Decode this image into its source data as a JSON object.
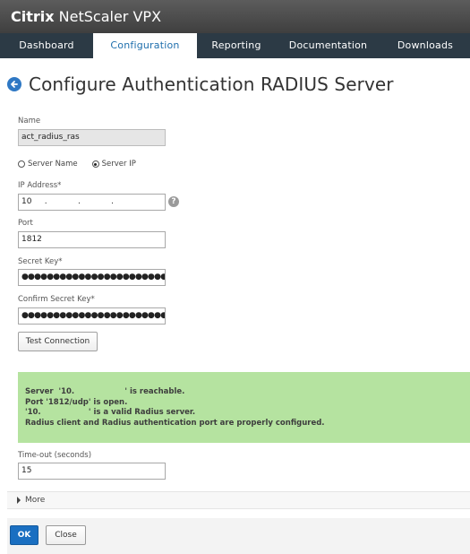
{
  "app": {
    "brand_bold": "Citrix",
    "brand_rest": "NetScaler VPX"
  },
  "nav": {
    "tabs": [
      {
        "label": "Dashboard"
      },
      {
        "label": "Configuration"
      },
      {
        "label": "Reporting"
      },
      {
        "label": "Documentation"
      },
      {
        "label": "Downloads"
      }
    ],
    "active_tab": "Configuration"
  },
  "page": {
    "title": "Configure Authentication RADIUS Server"
  },
  "form": {
    "name_label": "Name",
    "name_value": "act_radius_ras",
    "radio_server_name": "Server Name",
    "radio_server_ip": "Server IP",
    "radio_selected": "Server IP",
    "ip_label": "IP Address*",
    "ip_value": "10     .            .            .",
    "port_label": "Port",
    "port_value": "1812",
    "secret_label": "Secret Key*",
    "secret_value": "●●●●●●●●●●●●●●●●●●●●●●●●●●●",
    "confirm_label": "Confirm Secret Key*",
    "confirm_value": "●●●●●●●●●●●●●●●●●●●●●●●●●●●",
    "test_button": "Test Connection",
    "timeout_label": "Time-out (seconds)",
    "timeout_value": "15",
    "more_label": "More"
  },
  "message": {
    "lines": [
      "Server  '10.                   ' is reachable.",
      "Port '1812/udp' is open.",
      "'10.                  ' is a valid Radius server.",
      "Radius client and Radius authentication port are properly configured."
    ]
  },
  "footer": {
    "ok_label": "OK",
    "close_label": "Close"
  },
  "colors": {
    "accent": "#1a6fc1",
    "success_bg": "#b5e3a0",
    "nav_bg": "#2c3a45"
  }
}
